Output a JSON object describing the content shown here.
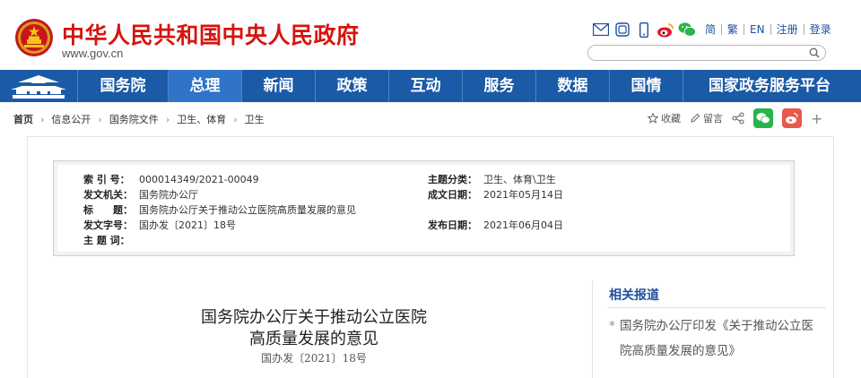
{
  "header": {
    "title": "中华人民共和国中央人民政府",
    "url": "www.gov.cn",
    "top_links": [
      "简",
      "繁",
      "EN",
      "注册",
      "登录"
    ],
    "icons": [
      "mail-icon",
      "app-icon",
      "mobile-icon",
      "weibo-icon",
      "wechat-icon"
    ]
  },
  "search": {
    "placeholder": ""
  },
  "nav": {
    "items": [
      "国务院",
      "总理",
      "新闻",
      "政策",
      "互动",
      "服务",
      "数据",
      "国情",
      "国家政务服务平台"
    ],
    "active_index": 1
  },
  "breadcrumb": [
    "首页",
    "信息公开",
    "国务院文件",
    "卫生、体育",
    "卫生"
  ],
  "share": {
    "favorite": "收藏",
    "comment": "留言",
    "more": "+"
  },
  "meta": {
    "index_label": "索 引 号：",
    "index_value": "000014349/2021-00049",
    "org_label": "发文机关：",
    "org_value": "国务院办公厅",
    "title_label": "标　　题：",
    "title_value": "国务院办公厅关于推动公立医院高质量发展的意见",
    "docno_label": "发文字号：",
    "docno_value": "国办发〔2021〕18号",
    "keywords_label": "主 题 词：",
    "keywords_value": "",
    "category_label": "主题分类：",
    "category_value": "卫生、体育\\卫生",
    "written_label": "成文日期：",
    "written_value": "2021年05月14日",
    "published_label": "发布日期：",
    "published_value": "2021年06月04日"
  },
  "document": {
    "title_line1": "国务院办公厅关于推动公立医院",
    "title_line2": "高质量发展的意见",
    "doc_number": "国办发〔2021〕18号"
  },
  "related": {
    "title": "相关报道",
    "items": [
      "国务院办公厅印发《关于推动公立医院高质量发展的意见》"
    ]
  },
  "colors": {
    "brand_red": "#d6140f",
    "nav_blue": "#1b5aa6",
    "nav_active": "#2f74c8",
    "link_blue": "#1f4f9c",
    "wechat_green": "#2bb24c",
    "weibo_red": "#e6594b"
  }
}
